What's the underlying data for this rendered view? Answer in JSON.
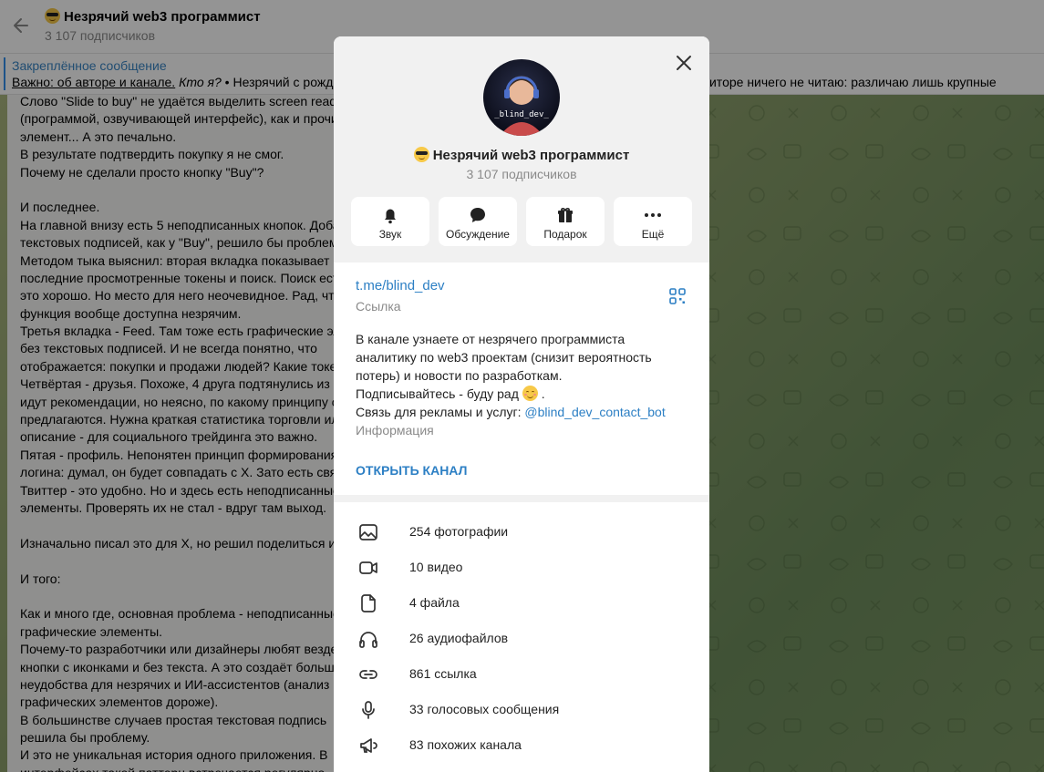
{
  "header": {
    "title": "Незрячий web3 программист",
    "subscribers": "3 107 подписчиков"
  },
  "pinned": {
    "title": "Закреплённое сообщение",
    "link_text": "Важно: об авторе и канале.",
    "italic_text": "Кто я?",
    "text": " • Незрячий с рождения. Программирую на слух, с помощью скринридера. На мониторе ничего не читаю: различаю лишь крупные"
  },
  "message": {
    "lines": [
      "Слово \"Slide to buy\" не удаётся выделить screen reader-ом",
      "(программой, озвучивающей интерфейс), как и прочие",
      "элемент... А это печально.",
      "В результате подтвердить покупку я не смог.",
      "Почему не сделали просто кнопку \"Buy\"?",
      "",
      "И последнее.",
      "На главной внизу есть 5 неподписанных кнопок. Добавление",
      "текстовых подписей, как у \"Buy\", решило бы проблему.",
      "Методом тыка выяснил: вторая вкладка показывает",
      "последние просмотренные токены и поиск. Поиск есть -",
      "это хорошо. Но место для него неочевидное. Рад, что эта",
      "функция вообще доступна незрячим.",
      "Третья вкладка - Feed. Там тоже есть графические элементы",
      "без текстовых подписей. И не всегда понятно, что",
      "отображается: покупки и продажи людей? Какие токены?",
      "Четвёртая - друзья. Похоже, 4 друга подтянулись из X. Далее",
      "идут рекомендации, но неясно, по какому принципу они",
      "предлагаются. Нужна краткая статистика торговли или",
      "описание - для социального трейдинга это важно.",
      "Пятая - профиль. Непонятен принцип формирования",
      "логина: думал, он будет совпадать с X. Зато есть связь с",
      "Твиттер - это удобно. Но и здесь есть неподписанные",
      "элементы. Проверять их не стал - вдруг там выход.",
      "",
      "Изначально писал это для X, но решил поделиться и здесь.",
      "",
      "И того:",
      "",
      "Как и много где, основная проблема - неподписанные",
      "графические элементы.",
      "Почему-то разработчики или дизайнеры любят везде ставить",
      "кнопки с иконками и без текста. А это создаёт большие",
      "неудобства для незрячих и ИИ-ассистентов (анализ",
      "графических элементов дороже).",
      "В большинстве случаев простая текстовая подпись",
      "решила бы проблему.",
      "И это не уникальная история одного приложения. В",
      "интерфейсах такой паттерн встречается регулярно."
    ]
  },
  "profile": {
    "avatar_label": "_blind_dev_",
    "name": "Незрячий web3 программист",
    "subscribers": "3 107 подписчиков",
    "actions": [
      {
        "label": "Звук",
        "icon": "bell-icon"
      },
      {
        "label": "Обсуждение",
        "icon": "chat-bubble-icon"
      },
      {
        "label": "Подарок",
        "icon": "gift-icon"
      },
      {
        "label": "Ещё",
        "icon": "more-icon"
      }
    ],
    "link": "t.me/blind_dev",
    "link_caption": "Ссылка",
    "description": {
      "line1": "В канале узнаете от незрячего программиста",
      "line2": "аналитику по web3 проектам (снизит вероятность",
      "line3": "потерь) и новости по разработкам.",
      "line4": "Подписывайтесь - буду рад",
      "line5_prefix": "Связь для рекламы и услуг: ",
      "line5_mention": "@blind_dev_contact_bot"
    },
    "description_caption": "Информация",
    "open_button": "ОТКРЫТЬ КАНАЛ",
    "media": [
      {
        "label": "254 фотографии",
        "icon": "photo-icon"
      },
      {
        "label": "10 видео",
        "icon": "video-icon"
      },
      {
        "label": "4 файла",
        "icon": "file-icon"
      },
      {
        "label": "26 аудиофайлов",
        "icon": "headphones-icon"
      },
      {
        "label": "861 ссылка",
        "icon": "link-icon"
      },
      {
        "label": "33 голосовых сообщения",
        "icon": "microphone-icon"
      },
      {
        "label": "83 похожих канала",
        "icon": "megaphone-icon"
      }
    ]
  },
  "colors": {
    "accent": "#2c7fc4",
    "pinned_bar": "#3390ec",
    "secondary_text": "#8a8a8a"
  }
}
